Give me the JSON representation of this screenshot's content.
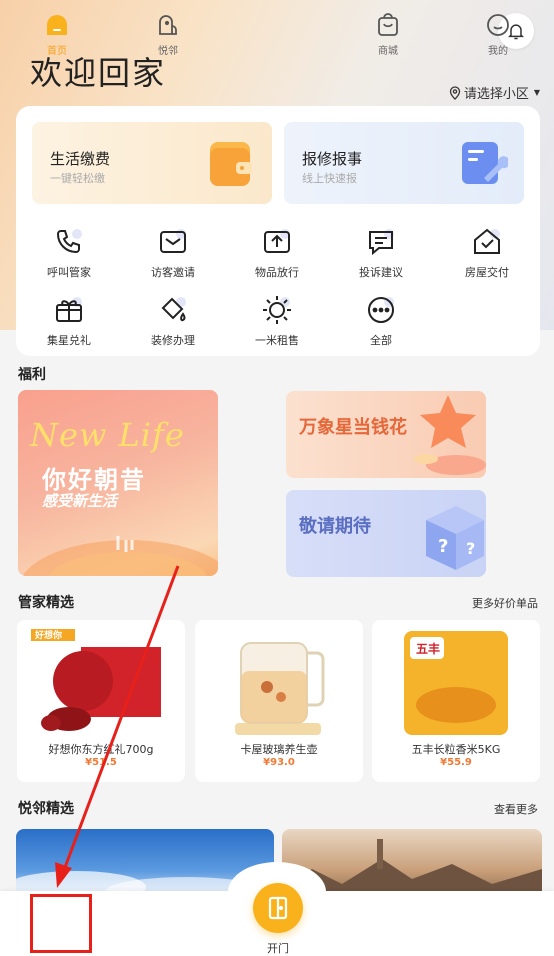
{
  "header": {
    "title": "欢迎回家",
    "community_label": "请选择小区"
  },
  "services": [
    {
      "title": "生活缴费",
      "subtitle": "一键轻松缴"
    },
    {
      "title": "报修报事",
      "subtitle": "线上快速报"
    }
  ],
  "grid": [
    {
      "label": "呼叫管家",
      "icon": "phone-icon"
    },
    {
      "label": "访客邀请",
      "icon": "envelope-icon"
    },
    {
      "label": "物品放行",
      "icon": "upload-icon"
    },
    {
      "label": "投诉建议",
      "icon": "chat-icon"
    },
    {
      "label": "房屋交付",
      "icon": "house-check-icon"
    },
    {
      "label": "集星兑礼",
      "icon": "gift-icon"
    },
    {
      "label": "装修办理",
      "icon": "paint-bucket-icon"
    },
    {
      "label": "一米租售",
      "icon": "sun-icon"
    },
    {
      "label": "全部",
      "icon": "more-icon"
    }
  ],
  "welfare": {
    "title": "福利",
    "banner_main": {
      "script": "New Life",
      "title": "你好朝昔",
      "subtitle": "感受新生活"
    },
    "banner_1": "万象星当钱花",
    "banner_2": "敬请期待"
  },
  "picks": {
    "title": "管家精选",
    "more": "更多好价单品",
    "products": [
      {
        "name": "好想你东方红礼700g",
        "price": "¥51.5",
        "package_brand": "好想你"
      },
      {
        "name": "卡屋玻璃养生壶",
        "price": "¥93.0"
      },
      {
        "name": "五丰长粒香米5KG",
        "price": "¥55.9",
        "package_brand": "五丰"
      }
    ]
  },
  "neighbor": {
    "title": "悦邻精选",
    "more": "查看更多"
  },
  "tabs": [
    {
      "label": "首页",
      "active": true
    },
    {
      "label": "悦邻"
    },
    {
      "label": "开门"
    },
    {
      "label": "商城"
    },
    {
      "label": "我的"
    }
  ],
  "colors": {
    "accent": "#f9b21c",
    "price": "#f07a35",
    "annotation": "#e8201a"
  }
}
